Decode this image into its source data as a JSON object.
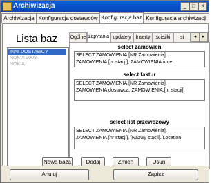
{
  "window": {
    "title": "Archiwizacja",
    "minimize": "_",
    "maximize": "□",
    "close": "×"
  },
  "tabs": [
    {
      "label": "Archiwizacja"
    },
    {
      "label": "Konfiguracja dostawców"
    },
    {
      "label": "Konfiguracja baz"
    },
    {
      "label": "Konfiguracja archiwizacji"
    }
  ],
  "lista": {
    "title": "Lista baz",
    "items": [
      {
        "label": "INNI DOSTAWCY"
      },
      {
        "label": "NOKIA 2009"
      },
      {
        "label": "NOKIA"
      }
    ]
  },
  "subtabs": [
    {
      "label": "Ogólne"
    },
    {
      "label": "zapytania"
    },
    {
      "label": "update'y"
    },
    {
      "label": "Inserty"
    },
    {
      "label": "ścieżki"
    },
    {
      "label": "si"
    }
  ],
  "scroll": {
    "left": "◂",
    "right": "▸"
  },
  "queries": {
    "zamowien": {
      "label": "select zamowien",
      "line1": "SELECT ZAMOWIENIA.[NR Zamowienia],",
      "line2": "ZAMOWIENIA.[nr stacji], ZAMOWIENIA.inne,"
    },
    "faktur": {
      "label": "select faktur",
      "line1": "SELECT ZAMOWIENIA.[NR Zamowienia],",
      "line2": "ZAMOWIENIA.dostawca, ZAMOWIENIA.[nr stacji],"
    },
    "przewozowy": {
      "label": "select list przewozowy",
      "line1": "SELECT ZAMOWIENIA.[NR Zamowienia],",
      "line2": "ZAMOWIENIA.[nr stacji], [Nazwy stacji].[Location"
    }
  },
  "buttons": {
    "nowa_baza": "Nowa baza",
    "dodaj": "Dodaj",
    "zmien": "Zmień",
    "usun": "Usuń",
    "anuluj": "Anuluj",
    "zapisz": "Zapisz"
  }
}
